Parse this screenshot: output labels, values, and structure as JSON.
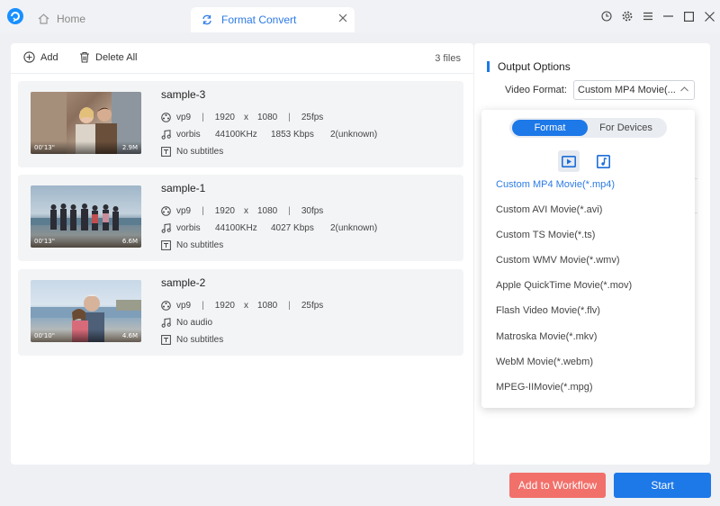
{
  "window": {
    "home_tab": "Home",
    "active_tab": "Format Convert",
    "logo_icon": "app-logo-icon",
    "controls": [
      "history-icon",
      "settings-icon",
      "menu-icon",
      "minimize-icon",
      "maximize-icon",
      "close-icon"
    ]
  },
  "toolbar": {
    "add_label": "Add",
    "delete_all_label": "Delete All",
    "file_count": "3 files"
  },
  "files": [
    {
      "name": "sample-3",
      "duration": "00'13\"",
      "size": "2.9M",
      "video": {
        "codec": "vp9",
        "width": "1920",
        "x": "x",
        "height": "1080",
        "fps": "25fps"
      },
      "audio": {
        "codec": "vorbis",
        "rate": "44100KHz",
        "bitrate": "1853 Kbps",
        "channels": "2(unknown)"
      },
      "subtitles": "No subtitles"
    },
    {
      "name": "sample-1",
      "duration": "00'13\"",
      "size": "6.6M",
      "video": {
        "codec": "vp9",
        "width": "1920",
        "x": "x",
        "height": "1080",
        "fps": "30fps"
      },
      "audio": {
        "codec": "vorbis",
        "rate": "44100KHz",
        "bitrate": "4027 Kbps",
        "channels": "2(unknown)"
      },
      "subtitles": "No subtitles"
    },
    {
      "name": "sample-2",
      "duration": "00'10\"",
      "size": "4.6M",
      "video": {
        "codec": "vp9",
        "width": "1920",
        "x": "x",
        "height": "1080",
        "fps": "25fps"
      },
      "audio": {
        "none": "No audio"
      },
      "subtitles": "No subtitles"
    }
  ],
  "output": {
    "title": "Output Options",
    "video_format_label": "Video Format:",
    "video_format_value": "Custom MP4 Movie(..."
  },
  "dropdown": {
    "tab_format": "Format",
    "tab_devices": "For Devices",
    "formats": [
      "Custom MP4 Movie(*.mp4)",
      "Custom AVI Movie(*.avi)",
      "Custom TS Movie(*.ts)",
      "Custom WMV Movie(*.wmv)",
      "Apple QuickTime Movie(*.mov)",
      "Flash Video Movie(*.flv)",
      "Matroska Movie(*.mkv)",
      "WebM Movie(*.webm)",
      "MPEG-IIMovie(*.mpg)"
    ],
    "selected_index": 0
  },
  "actions": {
    "workflow_label": "Add to Workflow",
    "start_label": "Start"
  },
  "colors": {
    "accent": "#1d78e8",
    "workflow": "#f2706a"
  }
}
